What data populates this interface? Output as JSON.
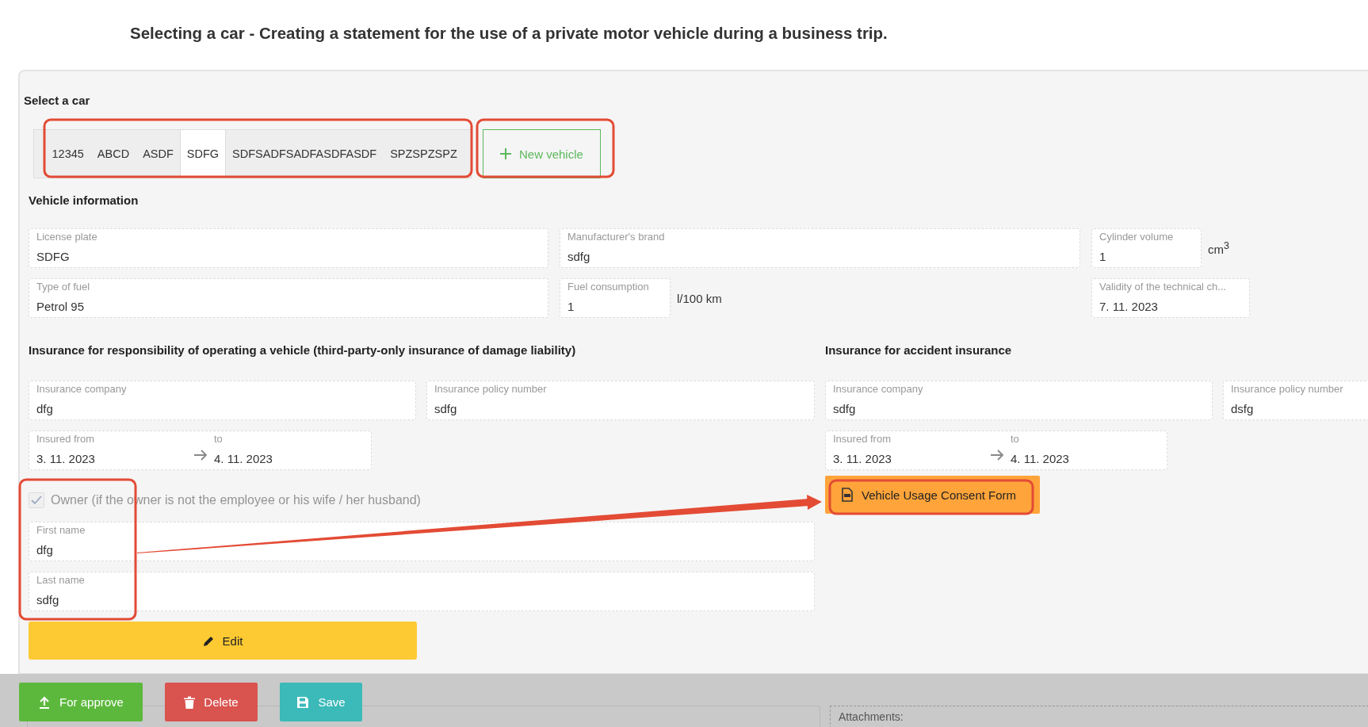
{
  "page_title": "Selecting a car - Creating a statement for the use of a private motor vehicle during a business trip.",
  "car_selection": {
    "heading": "Select a car",
    "tabs": [
      {
        "label": "12345",
        "selected": false
      },
      {
        "label": "ABCD",
        "selected": false
      },
      {
        "label": "ASDF",
        "selected": false
      },
      {
        "label": "SDFG",
        "selected": true
      },
      {
        "label": "SDFSADFSADFASDFASDF",
        "selected": false
      },
      {
        "label": "SPZSPZSPZ",
        "selected": false
      }
    ],
    "new_vehicle_button": "New vehicle"
  },
  "vehicle_information": {
    "heading": "Vehicle information",
    "fields": [
      {
        "label": "License plate",
        "value": "SDFG"
      },
      {
        "label": "Manufacturer's brand",
        "value": "sdfg"
      },
      {
        "label": "Cylinder volume",
        "value": "1",
        "unit": "cm$^{3}$"
      },
      {
        "label": "Type of fuel",
        "value": "Petrol 95"
      },
      {
        "label": "Fuel consumption",
        "value": "1",
        "unit": "l/100 km"
      },
      {
        "label": "Validity of the technical ch...",
        "value": "7. 11. 2023"
      }
    ]
  },
  "liability_insurance": {
    "heading": "Insurance for responsibility of operating a vehicle (third-party-only insurance of damage liability)",
    "company": {
      "label": "Insurance company",
      "value": "dfg"
    },
    "policy_number": {
      "label": "Insurance policy number",
      "value": "sdfg"
    },
    "period": {
      "from_label": "Insured from",
      "from": "3. 11. 2023",
      "to_label": "to",
      "to": "4. 11. 2023"
    }
  },
  "accident_insurance": {
    "heading": "Insurance for accident insurance",
    "company": {
      "label": "Insurance company",
      "value": "sdfg"
    },
    "policy_number": {
      "label": "Insurance policy number",
      "value": "dsfg"
    },
    "period": {
      "from_label": "Insured from",
      "from": "3. 11. 2023",
      "to_label": "to",
      "to": "4. 11. 2023"
    },
    "consent_button": "Vehicle Usage Consent Form"
  },
  "owner": {
    "checkbox": {
      "label": "Owner (if the owner is not the employee or his wife / her husband)",
      "checked": true,
      "disabled": true
    },
    "first_name": {
      "label": "First name",
      "value": "dfg"
    },
    "last_name": {
      "label": "Last name",
      "value": "sdfg"
    }
  },
  "edit_button": "Edit",
  "actions": [
    {
      "label": "For approve",
      "kind": "approve"
    },
    {
      "label": "Delete",
      "kind": "delete"
    },
    {
      "label": "Save",
      "kind": "save"
    }
  ],
  "attachments": {
    "label": "Attachments:"
  }
}
